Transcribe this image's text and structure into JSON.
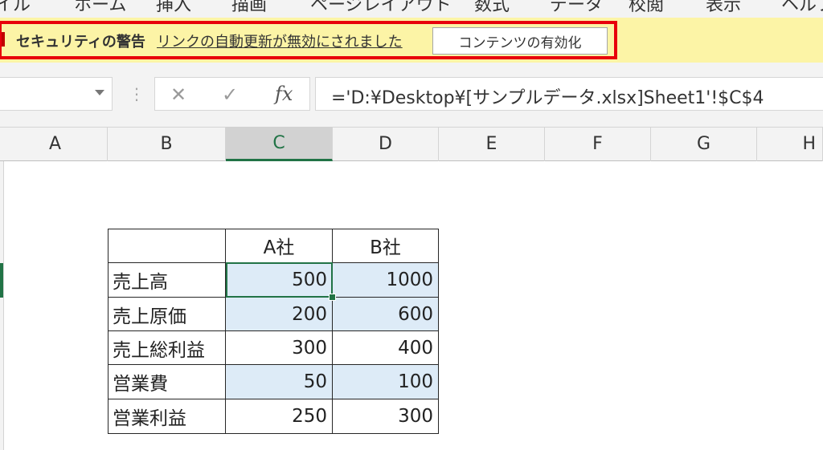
{
  "ribbon": {
    "tabs": [
      "イル",
      "ホーム",
      "挿入",
      "描画",
      "ページレイアウト",
      "数式",
      "データ",
      "校閲",
      "表示",
      "ヘルプ"
    ]
  },
  "security_bar": {
    "title": "セキュリティの警告",
    "message": "リンクの自動更新が無効にされました",
    "button_label": "コンテンツの有効化",
    "highlight_color": "#e8000b"
  },
  "formula_bar": {
    "name_box": "",
    "cancel_icon": "✕",
    "enter_icon": "✓",
    "fx_label": "fx",
    "formula": "='D:¥Desktop¥[サンプルデータ.xlsx]Sheet1'!$C$4"
  },
  "columns": [
    "A",
    "B",
    "C",
    "D",
    "E",
    "F",
    "G",
    "H"
  ],
  "selected_column": "C",
  "table": {
    "headers": [
      "",
      "A社",
      "B社"
    ],
    "rows": [
      {
        "label": "売上高",
        "a": "500",
        "b": "1000"
      },
      {
        "label": "売上原価",
        "a": "200",
        "b": "600"
      },
      {
        "label": "売上総利益",
        "a": "300",
        "b": "400"
      },
      {
        "label": "営業費",
        "a": "50",
        "b": "100"
      },
      {
        "label": "営業利益",
        "a": "250",
        "b": "300"
      }
    ]
  },
  "colors": {
    "accent": "#217346",
    "message_bar": "#fcf4a6",
    "highlight_fill": "#ddebf7"
  }
}
